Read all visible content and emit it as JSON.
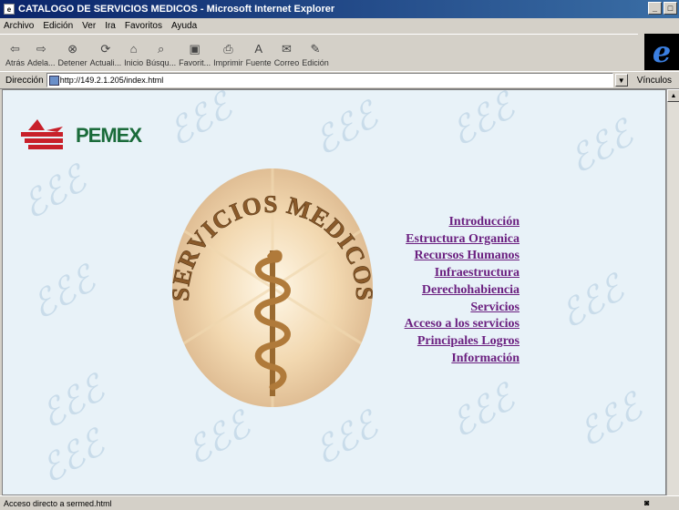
{
  "window": {
    "title": "CATALOGO DE SERVICIOS MEDICOS - Microsoft Internet Explorer"
  },
  "menubar": [
    "Archivo",
    "Edición",
    "Ver",
    "Ira",
    "Favoritos",
    "Ayuda"
  ],
  "toolbar": [
    {
      "label": "Atrás",
      "icon": "back-icon"
    },
    {
      "label": "Adela...",
      "icon": "forward-icon"
    },
    {
      "label": "Detener",
      "icon": "stop-icon"
    },
    {
      "label": "Actuali...",
      "icon": "refresh-icon"
    },
    {
      "label": "Inicio",
      "icon": "home-icon"
    },
    {
      "label": "Búsqu...",
      "icon": "search-icon"
    },
    {
      "label": "Favorit...",
      "icon": "favorites-icon"
    },
    {
      "label": "Imprimir",
      "icon": "print-icon"
    },
    {
      "label": "Fuente",
      "icon": "font-icon"
    },
    {
      "label": "Correo",
      "icon": "mail-icon"
    },
    {
      "label": "Edición",
      "icon": "edit-icon"
    }
  ],
  "address": {
    "label": "Dirección",
    "url": "http://149.2.1.205/index.html",
    "links_label": "Vínculos"
  },
  "logo": {
    "text": "PEMEX"
  },
  "emblem": {
    "arc_text": "SERVICIOS MEDICOS"
  },
  "nav": [
    "Introducción",
    "Estructura Organica",
    "Recursos Humanos",
    "Infraestructura",
    "Derechohabiencia",
    "Servicios",
    "Acceso a los servicios",
    "Principales Logros",
    "Información"
  ],
  "status": {
    "text": "Acceso directo a sermed.html"
  },
  "colors": {
    "link": "#6b2080",
    "pemex_green": "#1a6b3a",
    "pemex_red": "#c8202a"
  }
}
